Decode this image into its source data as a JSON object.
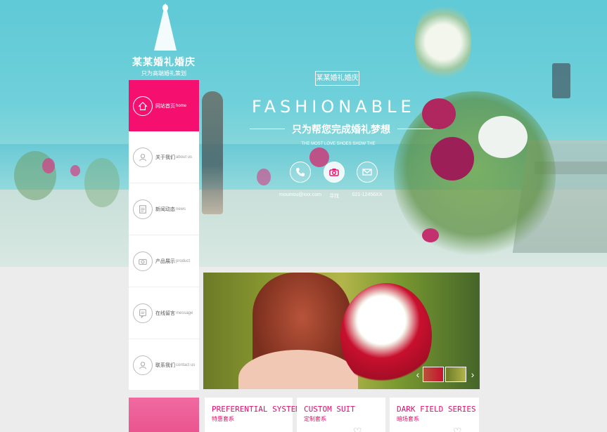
{
  "brand": {
    "title": "某某婚礼婚庆",
    "subtitle": "只为高端婚礼策划"
  },
  "hero": {
    "tag": "某某婚礼婚庆",
    "headline": "FASHIONABLE",
    "slogan": "只为帮您完成婚礼梦想",
    "tagline": "THE MOST LOVE SHOES SHOW THE",
    "contacts": [
      {
        "icon": "phone-icon",
        "label": "moumou@xxx.com"
      },
      {
        "icon": "camera-icon",
        "label": "寻找"
      },
      {
        "icon": "mail-icon",
        "label": "021-12456XX"
      }
    ]
  },
  "nav": {
    "items": [
      {
        "cn": "网站首页",
        "en": "home",
        "icon": "home-icon",
        "active": true
      },
      {
        "cn": "关于我们",
        "en": "about us",
        "icon": "user-icon"
      },
      {
        "cn": "新闻动态",
        "en": "news",
        "icon": "document-icon"
      },
      {
        "cn": "产品展示",
        "en": "product",
        "icon": "camera-icon"
      },
      {
        "cn": "在线留言",
        "en": "message",
        "icon": "chat-icon"
      },
      {
        "cn": "联系我们",
        "en": "contact us",
        "icon": "contact-icon"
      }
    ]
  },
  "slider": {
    "prev": "‹",
    "next": "›"
  },
  "cards": [
    {
      "en": "PREFERENTIAL SYSTEM",
      "cn": "特惠套系"
    },
    {
      "en": "CUSTOM SUIT",
      "cn": "定制套系"
    },
    {
      "en": "DARK FIELD SERIES",
      "cn": "暗场套系"
    }
  ],
  "colors": {
    "accent": "#f5106f",
    "hero_sky": "#5fc9d6"
  }
}
